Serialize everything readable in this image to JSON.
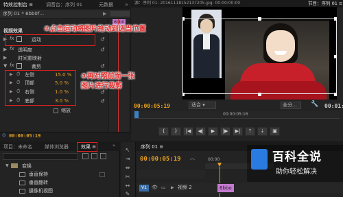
{
  "effect_controls": {
    "tabs": [
      "特效控制台 ≡",
      "调音台：序列 01",
      "元数据"
    ],
    "header_seq": "序列 01 * 6bb0f…",
    "section": "视频效果",
    "items": [
      {
        "label": "运动"
      },
      {
        "label": "透明度"
      },
      {
        "label": "时间重映射"
      },
      {
        "label": "裁剪"
      }
    ],
    "crop_params": [
      {
        "label": "左侧",
        "value": "15.0 %"
      },
      {
        "label": "顶部",
        "value": "5.0 %"
      },
      {
        "label": "右侧",
        "value": "1.0 %"
      },
      {
        "label": "底部",
        "value": "3.0 %"
      }
    ],
    "scale_label": "缩放",
    "timecode": "00:00:05:19",
    "clip_label": "6bb0"
  },
  "source_monitor": {
    "title": "源：序列 01: 20161118152137205.jpg: 00:00:00:00"
  },
  "program_monitor": {
    "title": "节目：序列 01 ≡",
    "timecode": "00:00:05:19",
    "fit": "适合",
    "quality": "全分…",
    "timecode_right": "00:01:",
    "ruler_time": "00:00:05:16",
    "play": "▶"
  },
  "project_panel": {
    "tabs": [
      "项目：未命名",
      "媒体浏览器",
      "效果 ≡"
    ],
    "folder": "变换",
    "items": [
      "垂直保持",
      "垂直翻转",
      "摄像机视图"
    ]
  },
  "timeline": {
    "tab": "序列 01 ≡",
    "timecode": "00:00:05:19",
    "ruler": "00:00",
    "track_label": "V1",
    "track_name": "视频 2",
    "clip": "6bbo"
  },
  "annotations": {
    "a2": "②点击运动将图片拖动到适当位置",
    "a3_line1": "③再对照前面一张",
    "a3_line2": "图片进行裁剪"
  },
  "watermark": {
    "title": "百科全说",
    "subtitle": "助你轻松解决"
  }
}
